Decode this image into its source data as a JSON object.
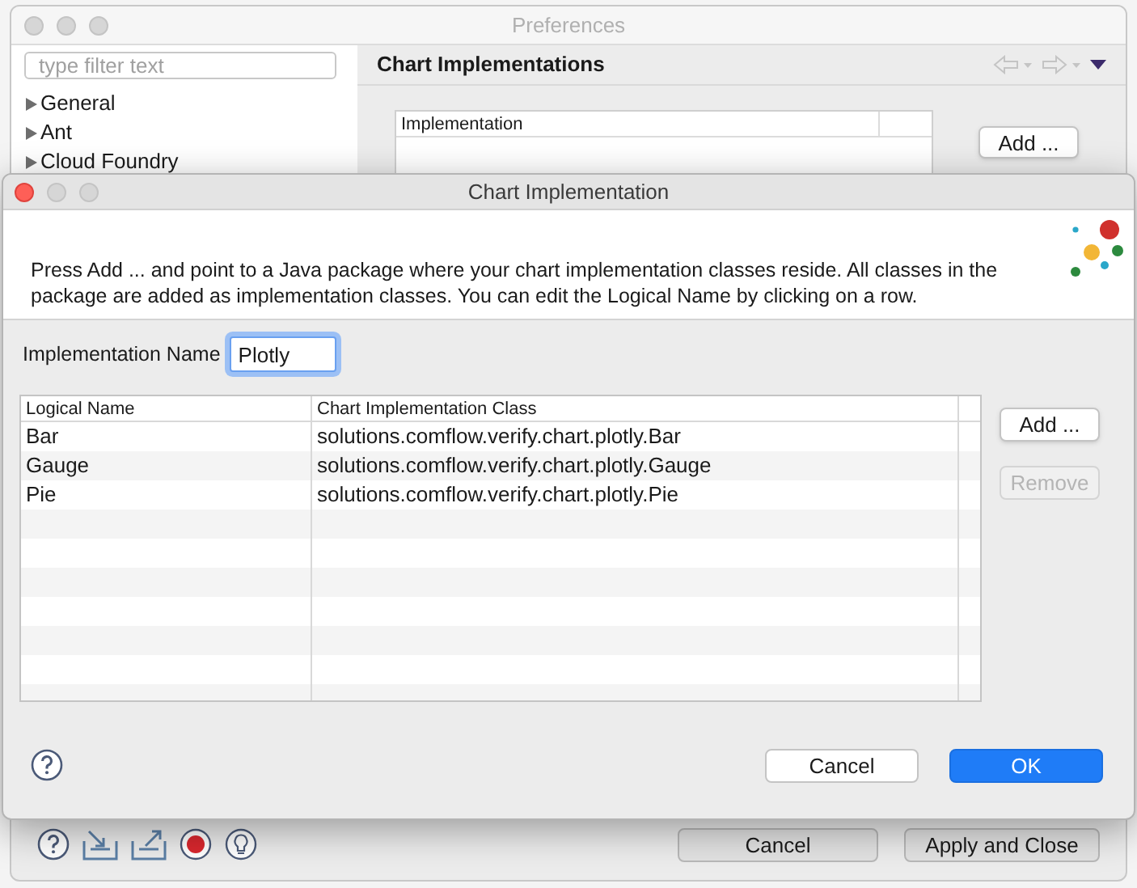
{
  "preferences_window": {
    "title": "Preferences",
    "filter": {
      "placeholder": "type filter text"
    },
    "tree": [
      {
        "label": "General",
        "expanded": false
      },
      {
        "label": "Ant",
        "expanded": false
      },
      {
        "label": "Cloud Foundry",
        "expanded": false
      }
    ],
    "page_title": "Chart Implementations",
    "table": {
      "columns": [
        "Implementation"
      ]
    },
    "add_button": "Add ...",
    "bottom_buttons": [
      "Cancel",
      "Apply and Close"
    ]
  },
  "dialog": {
    "title": "Chart Implementation",
    "description": "Press Add ... and point to a Java package where your chart implementation classes reside. All classes in the package are added as implementation classes. You can edit the Logical Name by clicking on a row.",
    "name_field": {
      "label": "Implementation Name",
      "value": "Plotly"
    },
    "table": {
      "columns": [
        "Logical Name",
        "Chart Implementation Class"
      ],
      "rows": [
        {
          "logical_name": "Bar",
          "class": "solutions.comflow.verify.chart.plotly.Bar"
        },
        {
          "logical_name": "Gauge",
          "class": "solutions.comflow.verify.chart.plotly.Gauge"
        },
        {
          "logical_name": "Pie",
          "class": "solutions.comflow.verify.chart.plotly.Pie"
        }
      ]
    },
    "side_buttons": [
      {
        "label": "Add ...",
        "disabled": false
      },
      {
        "label": "Remove",
        "disabled": true
      }
    ],
    "buttons": [
      {
        "label": "Cancel",
        "default": false
      },
      {
        "label": "OK",
        "default": true
      }
    ]
  }
}
